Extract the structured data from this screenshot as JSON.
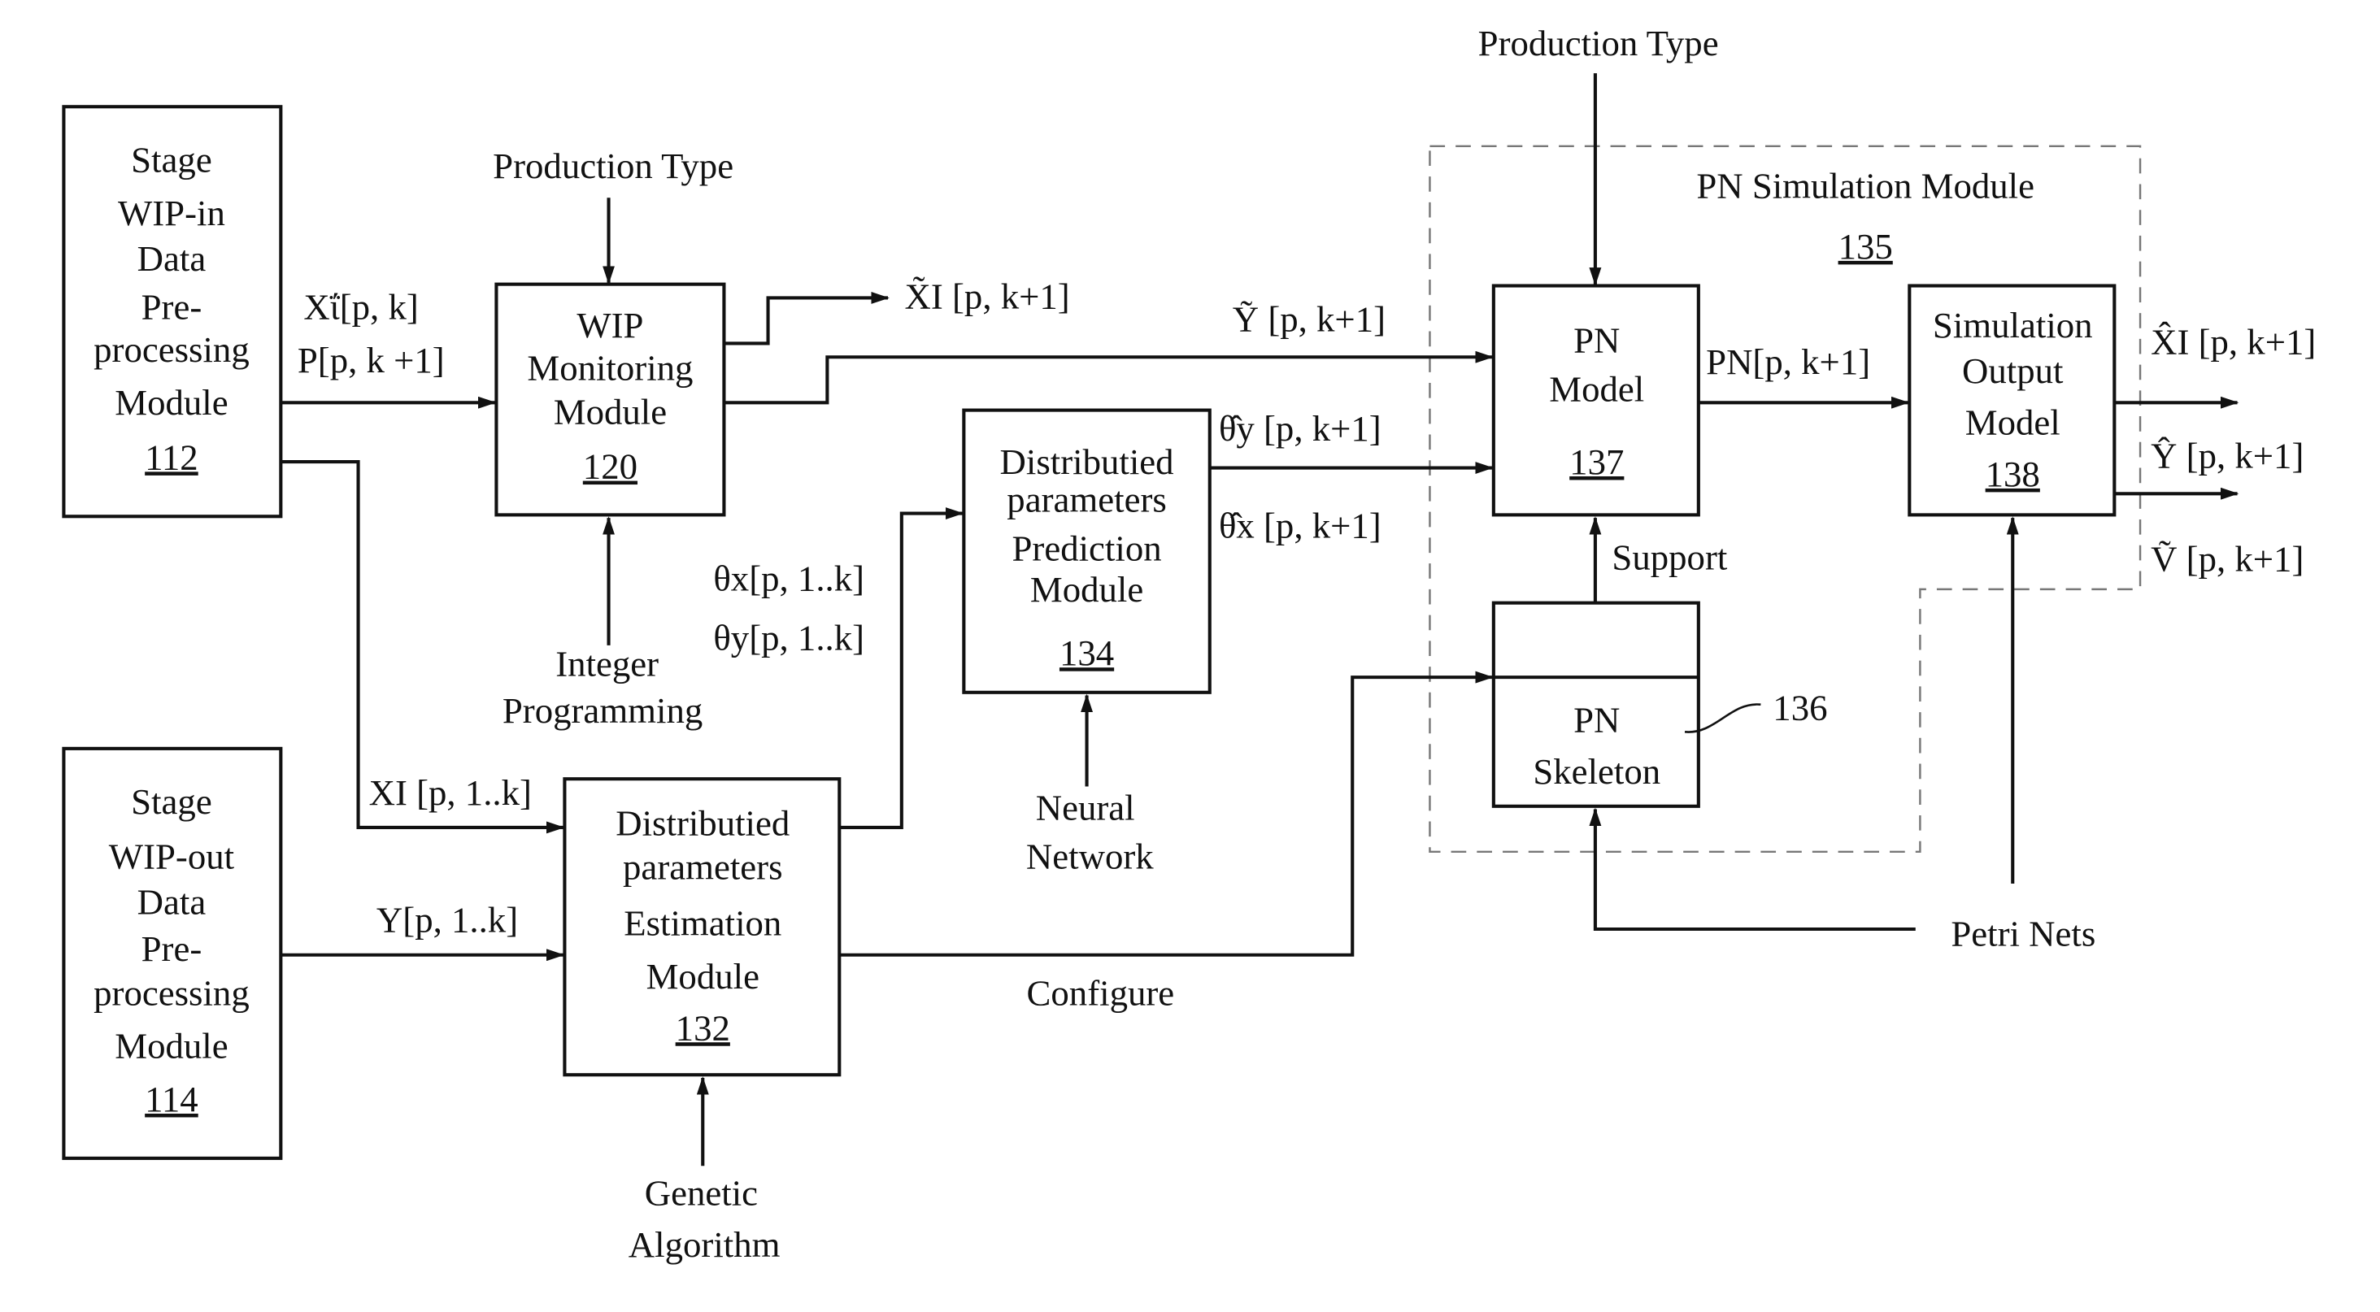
{
  "modules": {
    "m112": {
      "lines": [
        "Stage",
        "WIP-in",
        "Data",
        "Pre-",
        "processing",
        "Module"
      ],
      "number": "112"
    },
    "m114": {
      "lines": [
        "Stage",
        "WIP-out",
        "Data",
        "Pre-",
        "processing",
        "Module"
      ],
      "number": "114"
    },
    "m120": {
      "lines": [
        "WIP",
        "Monitoring",
        "Module"
      ],
      "number": "120"
    },
    "m132": {
      "lines": [
        "Distributied",
        "parameters",
        "Estimation",
        "Module"
      ],
      "number": "132"
    },
    "m134": {
      "lines": [
        "Distributied",
        "parameters",
        "Prediction",
        "Module"
      ],
      "number": "134"
    },
    "m137": {
      "lines": [
        "PN",
        "Model"
      ],
      "number": "137"
    },
    "m136": {
      "lines": [
        "PN",
        "Skeleton"
      ],
      "number": "136"
    },
    "m138": {
      "lines": [
        "Simulation",
        "Output",
        "Model"
      ],
      "number": "138"
    },
    "m135": {
      "title": "PN Simulation Module",
      "number": "135"
    }
  },
  "inputs": {
    "production_type_1": "Production Type",
    "production_type_2": "Production Type",
    "integer_programming": [
      "Integer",
      "Programming"
    ],
    "neural_network": [
      "Neural",
      "Network"
    ],
    "genetic_algorithm": [
      "Genetic",
      "Algorithm"
    ],
    "petri_nets": "Petri Nets"
  },
  "signals": {
    "xi_pk": "Xΐ[p, k]",
    "p_pk1": "P[p, k +1]",
    "xi_tilde": "X̃I [p, k+1]",
    "y_tilde": "Ỹ [p, k+1]",
    "theta_y_hat": "θ̂y [p, k+1]",
    "theta_x_hat": "θ̂x [p, k+1]",
    "theta_x_hist": "θx[p, 1..k]",
    "theta_y_hist": "θy[p, 1..k]",
    "xi_hist": "XI [p, 1..k]",
    "y_hist": "Y[p, 1..k]",
    "configure": "Configure",
    "support": "Support",
    "pn_pk1": "PN[p, k+1]",
    "xi_hat": "X̂I [p, k+1]",
    "y_hat": "Ŷ [p, k+1]",
    "v_tilde": "Ṽ [p, k+1]"
  }
}
